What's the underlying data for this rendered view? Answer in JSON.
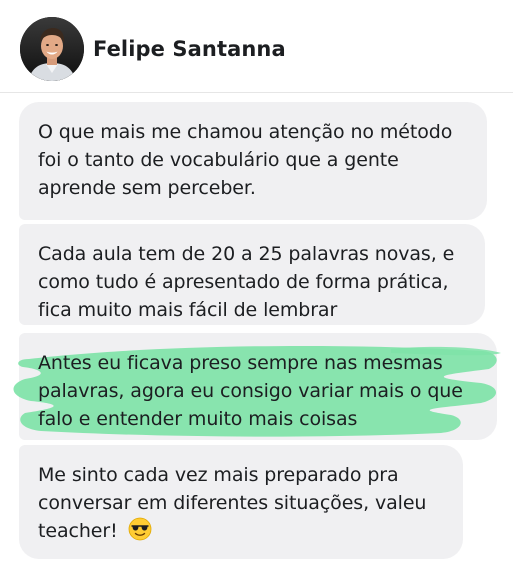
{
  "contact": {
    "name": "Felipe Santanna",
    "avatar_icon": "person-photo-icon"
  },
  "messages": [
    {
      "lines": [
        "O que mais me chamou atenção no método",
        "foi o tanto de vocabulário que a gente",
        "aprende sem perceber."
      ]
    },
    {
      "lines": [
        "Cada aula tem de 20 a 25 palavras novas, e",
        "como tudo é apresentado de forma prática,",
        "fica muito mais fácil de lembrar"
      ]
    },
    {
      "lines": [
        "Antes eu ficava preso sempre nas mesmas",
        "palavras, agora eu consigo variar mais o que",
        "falo e entender muito mais coisas"
      ],
      "highlight_color": "#7fe3a8"
    },
    {
      "lines": [
        "Me sinto cada vez mais preparado pra",
        "conversar em diferentes situações, valeu",
        "teacher!"
      ],
      "emoji": "smiling-face-with-sunglasses-icon"
    }
  ],
  "colors": {
    "bubble": "#f0f0f2",
    "text": "#1c1e21",
    "highlight": "#7fe3a8"
  }
}
